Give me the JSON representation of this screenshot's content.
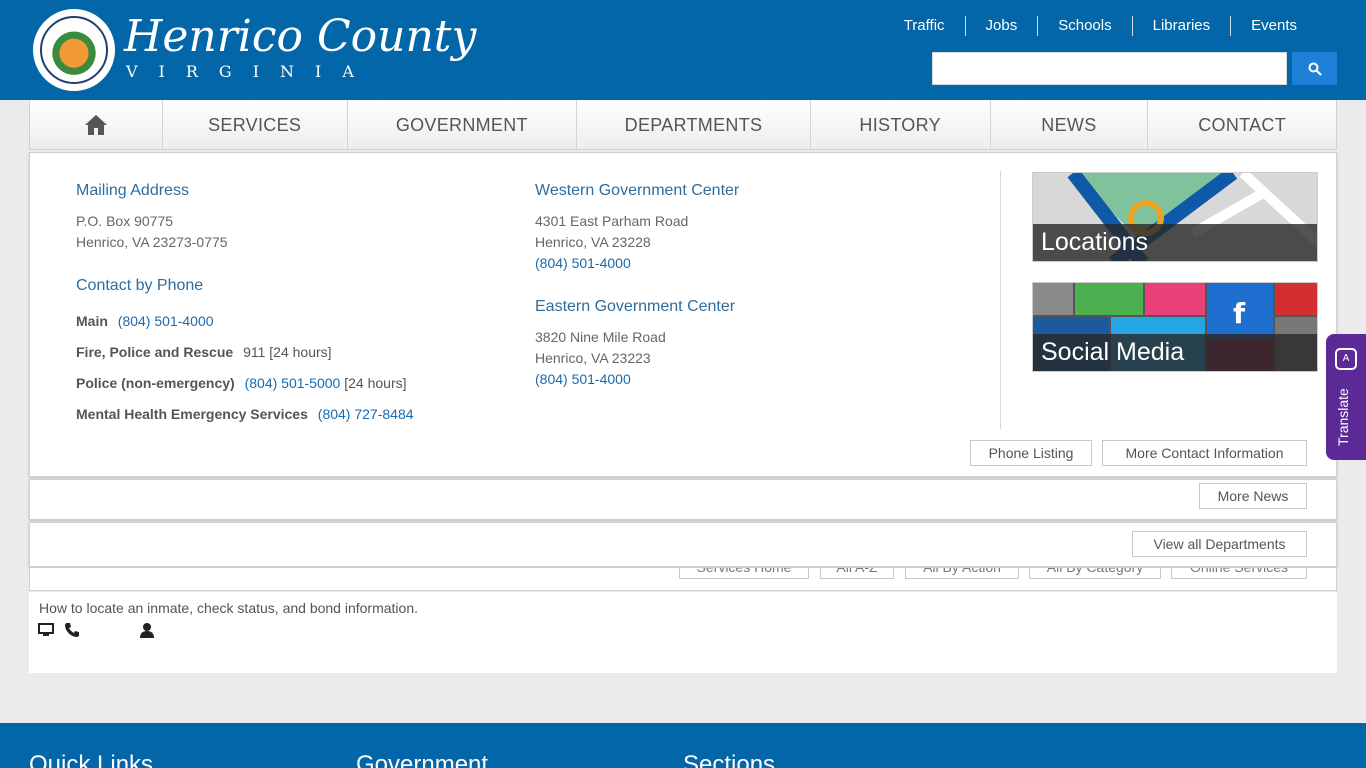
{
  "brand": {
    "title": "Henrico County",
    "subtitle": "VIRGINIA",
    "seal_text": "COUNTY OF HENRICO, VIRGINIA"
  },
  "top_links": [
    "Traffic",
    "Jobs",
    "Schools",
    "Libraries",
    "Events"
  ],
  "search": {
    "placeholder": "",
    "value": ""
  },
  "nav": {
    "home_icon": "home-icon",
    "items": [
      "SERVICES",
      "GOVERNMENT",
      "DEPARTMENTS",
      "HISTORY",
      "NEWS",
      "CONTACT"
    ]
  },
  "contact": {
    "mailing": {
      "heading": "Mailing Address",
      "line1": "P.O. Box 90775",
      "line2": "Henrico, VA 23273-0775"
    },
    "phone_heading": "Contact by Phone",
    "phones": [
      {
        "label": "Main",
        "number": "(804) 501-4000",
        "note": ""
      },
      {
        "label": "Fire, Police and Rescue",
        "number": "911",
        "note": "[24 hours]"
      },
      {
        "label": "Police (non-emergency)",
        "number": "(804) 501-5000",
        "note": "[24 hours]"
      },
      {
        "label": "Mental Health Emergency Services",
        "number": "(804) 727-8484",
        "note": ""
      }
    ],
    "western": {
      "heading": "Western Government Center",
      "line1": "4301 East Parham Road",
      "line2": "Henrico, VA 23228",
      "phone": "(804) 501-4000"
    },
    "eastern": {
      "heading": "Eastern Government Center",
      "line1": "3820 Nine Mile Road",
      "line2": "Henrico, VA 23223",
      "phone": "(804) 501-4000"
    },
    "tiles": [
      "Locations",
      "Social Media"
    ],
    "buttons": [
      "Phone Listing",
      "More Contact Information"
    ]
  },
  "news": {
    "button": "More News"
  },
  "departments": {
    "button": "View all Departments"
  },
  "services_buttons": [
    "Services Home",
    "All A-Z",
    "All By Action",
    "All By Category",
    "Online Services"
  ],
  "content": {
    "description": "How to locate an inmate, check status, and bond information."
  },
  "footer": {
    "headings": [
      "Quick Links",
      "Government",
      "Sections"
    ]
  },
  "translate": {
    "label": "Translate"
  },
  "colors": {
    "header": "#0366a8",
    "accent": "#1e7fd6",
    "translate": "#5b2a96",
    "link": "#1a6aaf"
  }
}
